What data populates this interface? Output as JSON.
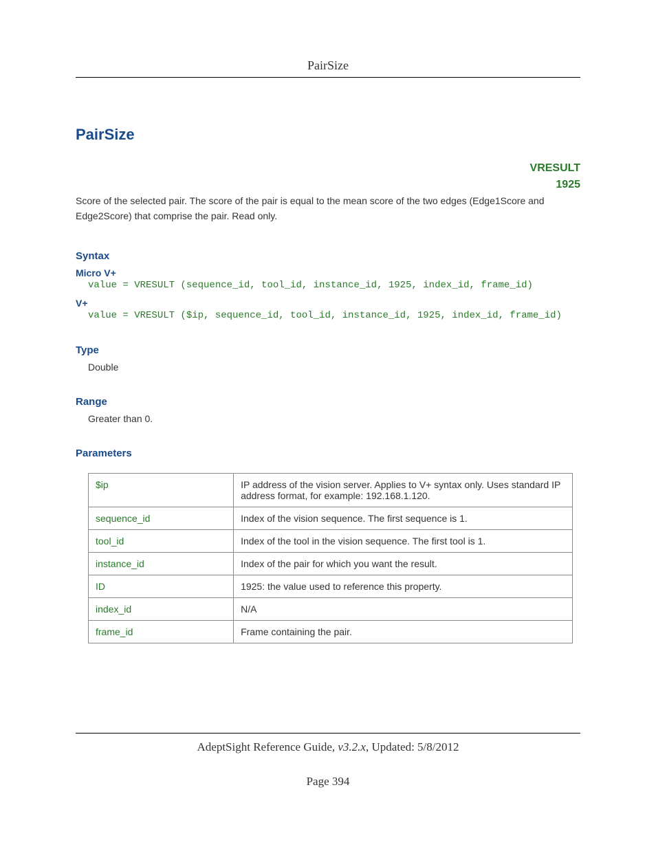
{
  "header": {
    "running_title": "PairSize"
  },
  "title": "PairSize",
  "badge": {
    "kind": "VRESULT",
    "code": "1925"
  },
  "description": "Score of the selected pair. The score of the pair is equal to the mean score of the two edges (Edge1Score and Edge2Score) that comprise the pair. Read only.",
  "syntax": {
    "heading": "Syntax",
    "micro_label": "Micro V+",
    "micro_code": "value = VRESULT (sequence_id, tool_id, instance_id, 1925, index_id, frame_id)",
    "vplus_label": "V+",
    "vplus_code": "value = VRESULT ($ip, sequence_id, tool_id, instance_id, 1925, index_id, frame_id)"
  },
  "type": {
    "heading": "Type",
    "value": "Double"
  },
  "range": {
    "heading": "Range",
    "value": "Greater than 0."
  },
  "parameters": {
    "heading": "Parameters",
    "rows": [
      {
        "name": "$ip",
        "desc": "IP address of the vision server. Applies to V+ syntax only. Uses standard IP address format, for example: 192.168.1.120."
      },
      {
        "name": "sequence_id",
        "desc": "Index of the vision sequence. The first sequence is 1."
      },
      {
        "name": "tool_id",
        "desc": "Index of the tool in the vision sequence. The first tool is 1."
      },
      {
        "name": "instance_id",
        "desc": "Index of the pair for which you want the result."
      },
      {
        "name": "ID",
        "desc": "1925: the value used to reference this property."
      },
      {
        "name": "index_id",
        "desc": "N/A"
      },
      {
        "name": "frame_id",
        "desc": "Frame containing the pair."
      }
    ]
  },
  "footer": {
    "guide": "AdeptSight Reference Guide",
    "version": ", v3.2.x",
    "updated": ", Updated: 5/8/2012",
    "page": "Page 394"
  }
}
